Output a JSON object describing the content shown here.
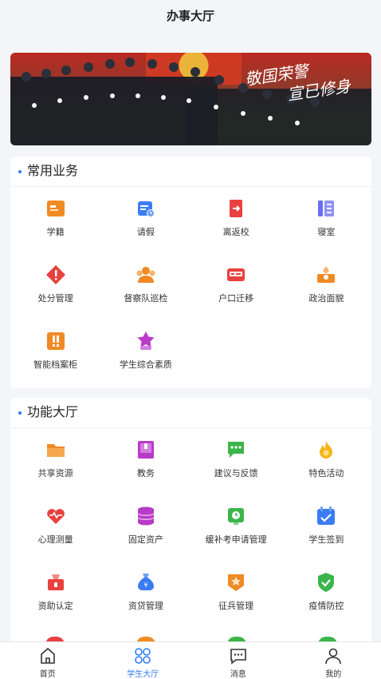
{
  "header": {
    "title": "办事大厅"
  },
  "banner": {
    "line1": "敬国荣警",
    "line2": "宣已修身"
  },
  "common": {
    "title": "常用业务",
    "items": [
      {
        "label": "学籍",
        "icon": "student-card-icon",
        "color": "#f08a24"
      },
      {
        "label": "请假",
        "icon": "calendar-clock-icon",
        "color": "#3c7cf3"
      },
      {
        "label": "离返校",
        "icon": "exit-door-icon",
        "color": "#e8413f"
      },
      {
        "label": "寝室",
        "icon": "dorm-list-icon",
        "color": "#6a6cf3"
      },
      {
        "label": "处分管理",
        "icon": "warning-diamond-icon",
        "color": "#e8413f"
      },
      {
        "label": "督察队巡检",
        "icon": "inspection-team-icon",
        "color": "#f08a24"
      },
      {
        "label": "户口迁移",
        "icon": "id-card-icon",
        "color": "#e8413f"
      },
      {
        "label": "政治面貌",
        "icon": "party-badge-icon",
        "color": "#f08a24"
      },
      {
        "label": "智能档案柜",
        "icon": "archive-cabinet-icon",
        "color": "#f08a24"
      },
      {
        "label": "学生综合素质",
        "icon": "star-badge-icon",
        "color": "#b83bc7"
      }
    ]
  },
  "functions": {
    "title": "功能大厅",
    "items": [
      {
        "label": "共享资源",
        "icon": "folder-icon",
        "color": "#f08a24"
      },
      {
        "label": "教务",
        "icon": "book-icon",
        "color": "#b83bc7"
      },
      {
        "label": "建议与反馈",
        "icon": "chat-bubble-icon",
        "color": "#3bb54a"
      },
      {
        "label": "特色活动",
        "icon": "flame-icon",
        "color": "#f5b51b"
      },
      {
        "label": "心理测量",
        "icon": "heart-pulse-icon",
        "color": "#e8413f"
      },
      {
        "label": "固定资产",
        "icon": "database-icon",
        "color": "#b83bc7"
      },
      {
        "label": "缓补考申请管理",
        "icon": "exam-clock-icon",
        "color": "#3bb54a"
      },
      {
        "label": "学生签到",
        "icon": "checkin-calendar-icon",
        "color": "#3c7cf3"
      },
      {
        "label": "资助认定",
        "icon": "aid-box-icon",
        "color": "#e8413f"
      },
      {
        "label": "资贷管理",
        "icon": "money-bag-icon",
        "color": "#3c7cf3"
      },
      {
        "label": "征兵管理",
        "icon": "military-badge-icon",
        "color": "#f08a24"
      },
      {
        "label": "疫情防控",
        "icon": "shield-check-icon",
        "color": "#3bb54a"
      }
    ]
  },
  "tabbar": {
    "items": [
      {
        "label": "首页",
        "icon": "home-icon",
        "active": false
      },
      {
        "label": "学生大厅",
        "icon": "grid-icon",
        "active": true
      },
      {
        "label": "消息",
        "icon": "message-icon",
        "active": false
      },
      {
        "label": "我的",
        "icon": "user-icon",
        "active": false
      }
    ]
  }
}
